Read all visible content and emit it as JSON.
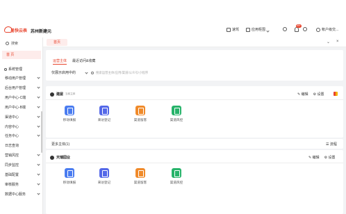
{
  "header": {
    "logo_text": "易快云表",
    "tenant": "苏州新建元",
    "quick": "速驾",
    "app_market": "应用柜围",
    "notif_count": "99+",
    "account": "帐户级交..."
  },
  "sidebar": {
    "search": "搜索",
    "home": "首 页",
    "items": [
      {
        "label": "系统管理"
      },
      {
        "label": "移动用户管理"
      },
      {
        "label": "后台用户管理"
      },
      {
        "label": "用户中心-C端"
      },
      {
        "label": "用户中心-B端"
      },
      {
        "label": "渠道中心"
      },
      {
        "label": "内容中心"
      },
      {
        "label": "任务中心"
      },
      {
        "label": "日志查询"
      },
      {
        "label": "营销风控"
      },
      {
        "label": "同步监控"
      },
      {
        "label": "基础配置"
      },
      {
        "label": "审核服务"
      },
      {
        "label": "数据中心服务"
      }
    ]
  },
  "tabs": {
    "home": "首页"
  },
  "panel": {
    "tab_active": "运营主体",
    "tab_recent": "最近访问&收藏",
    "select_value": "仅展示启用中的",
    "search_placeholder": "搜索运营主体/应用/渠道/公众号/小程序"
  },
  "section1": {
    "title": "建屋",
    "subtitle": "当前主体",
    "edit": "编辑",
    "settings": "设置",
    "apps": [
      {
        "label": "移动填报",
        "color": "#4a7cf0"
      },
      {
        "label": "来访登记",
        "color": "#5468e8"
      },
      {
        "label": "渠道留客",
        "color": "#f08a2a"
      },
      {
        "label": "渠道风控",
        "color": "#27b36a"
      }
    ]
  },
  "more": {
    "title": "更多主体(1)",
    "flow": "流程"
  },
  "section2": {
    "title": "天瑞园业",
    "edit": "编辑",
    "settings": "设置",
    "apps": [
      {
        "label": "移动填报",
        "color": "#4a7cf0"
      },
      {
        "label": "来访登记",
        "color": "#5468e8"
      },
      {
        "label": "渠道留客",
        "color": "#f08a2a"
      },
      {
        "label": "渠道风控",
        "color": "#27b36a"
      }
    ]
  }
}
